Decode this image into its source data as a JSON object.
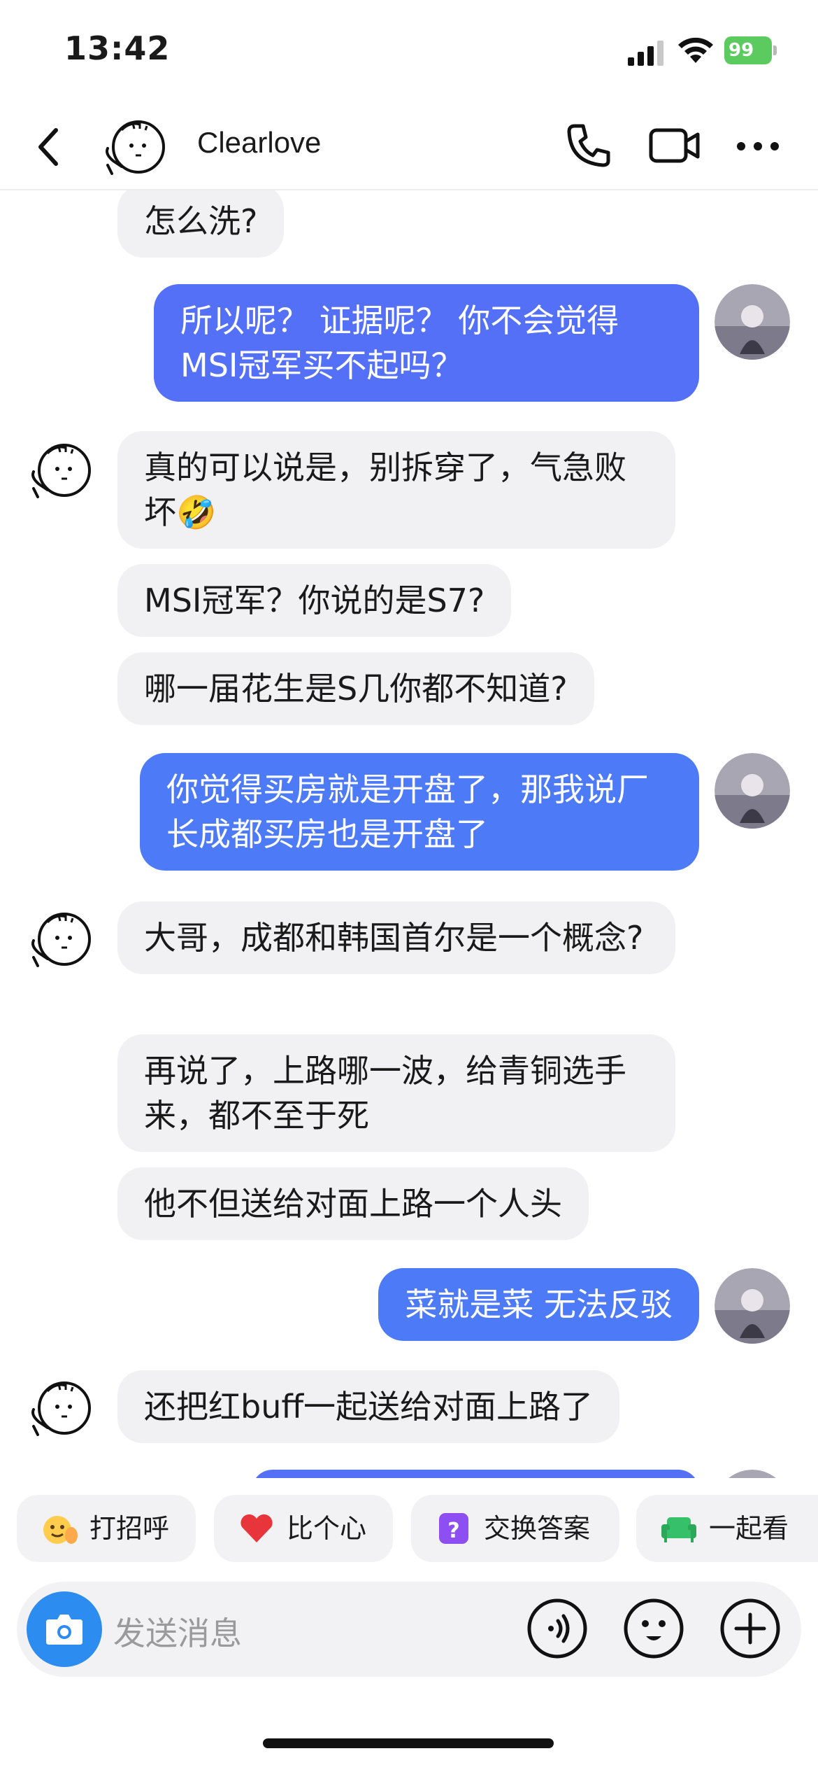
{
  "status_bar": {
    "time": "13:42",
    "battery": "99"
  },
  "header": {
    "title": "Clearlove"
  },
  "messages": [
    {
      "side": "in",
      "text": "怎么洗?"
    },
    {
      "side": "out",
      "text": "所以呢？ 证据呢？ 你不会觉得MSI冠军买不起吗？"
    },
    {
      "side": "in",
      "text": "真的可以说是，别拆穿了，气急败坏🤣"
    },
    {
      "side": "in",
      "text": "MSI冠军？你说的是S7?"
    },
    {
      "side": "in",
      "text": "哪一届花生是S几你都不知道?"
    },
    {
      "side": "out",
      "text": "你觉得买房就是开盘了，那我说厂长成都买房也是开盘了"
    },
    {
      "side": "in",
      "text": "大哥，成都和韩国首尔是一个概念?"
    },
    {
      "side": "in",
      "text": "再说了，上路哪一波，给青铜选手来，都不至于死"
    },
    {
      "side": "in",
      "text": "他不但送给对面上路一个人头"
    },
    {
      "side": "out",
      "text": "菜就是菜 无法反驳"
    },
    {
      "side": "in",
      "text": "还把红buff一起送给对面上路了"
    }
  ],
  "chips": [
    {
      "label": "打招呼",
      "icon": "wave-hand-icon"
    },
    {
      "label": "比个心",
      "icon": "heart-icon"
    },
    {
      "label": "交换答案",
      "icon": "question-box-icon"
    },
    {
      "label": "一起看",
      "icon": "sofa-icon"
    }
  ],
  "input": {
    "placeholder": "发送消息"
  }
}
